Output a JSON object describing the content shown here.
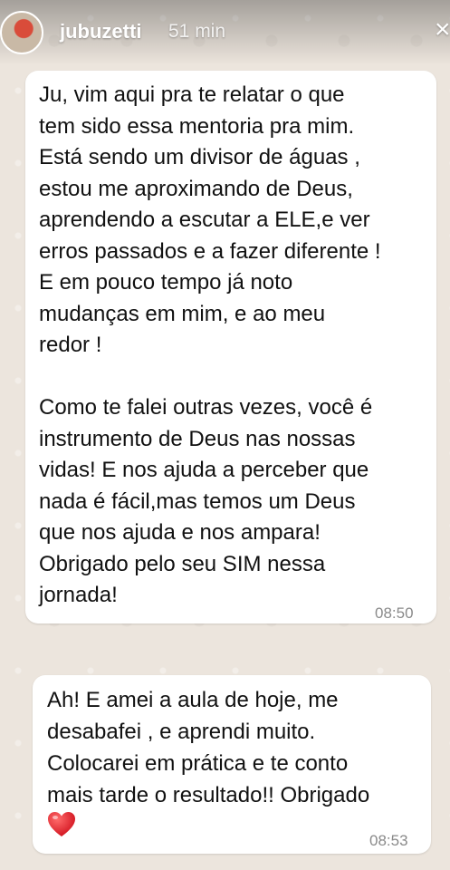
{
  "story": {
    "username": "jubuzetti",
    "time_ago": "51 min",
    "close_glyph": "×"
  },
  "messages": [
    {
      "text": "Ju, vim aqui pra te relatar o que\ntem sido essa mentoria pra mim.\nEstá sendo um divisor de águas ,\nestou me aproximando de Deus,\naprendendo a escutar a ELE,e ver\nerros passados e a fazer diferente !\nE em pouco tempo já noto\nmudanças em mim, e ao meu\nredor !\n\nComo te falei outras vezes, você é\ninstrumento de Deus nas nossas\nvidas! E nos ajuda a perceber que\nnada é fácil,mas temos um Deus\nque nos ajuda e nos ampara!\nObrigado pelo seu SIM nessa\njornada!",
      "time": "08:50"
    },
    {
      "text": "Ah! E amei a aula de hoje, me\ndesabafei , e aprendi muito.\nColocarei em prática e te conto\nmais tarde o resultado!! Obrigado",
      "emoji": "heart-icon",
      "time": "08:53"
    }
  ],
  "colors": {
    "bubble": "#ffffff",
    "background": "#ece5dd",
    "heart": "#e0202a",
    "timestamp": "#8a8a8a"
  }
}
